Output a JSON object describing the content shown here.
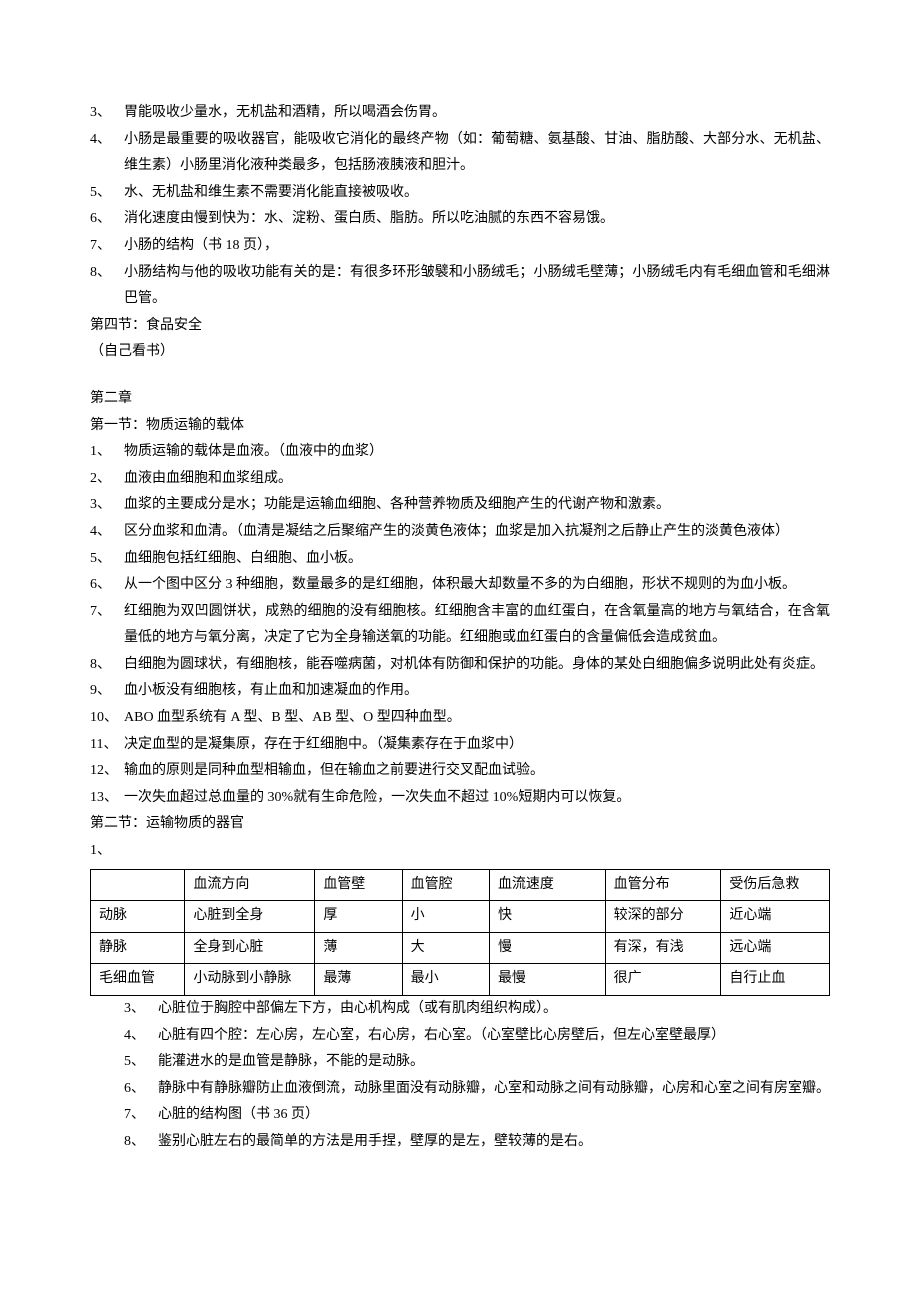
{
  "top_items": [
    {
      "num": "3、",
      "text": "胃能吸收少量水，无机盐和酒精，所以喝酒会伤胃。"
    },
    {
      "num": "4、",
      "text": "小肠是最重要的吸收器官，能吸收它消化的最终产物（如：葡萄糖、氨基酸、甘油、脂肪酸、大部分水、无机盐、维生素）小肠里消化液种类最多，包括肠液胰液和胆汁。"
    },
    {
      "num": "5、",
      "text": "水、无机盐和维生素不需要消化能直接被吸收。"
    },
    {
      "num": "6、",
      "text": "消化速度由慢到快为：水、淀粉、蛋白质、脂肪。所以吃油腻的东西不容易饿。"
    },
    {
      "num": "7、",
      "text": "小肠的结构（书 18 页），"
    },
    {
      "num": "8、",
      "text": "小肠结构与他的吸收功能有关的是：有很多环形皱襞和小肠绒毛；小肠绒毛壁薄；小肠绒毛内有毛细血管和毛细淋巴管。"
    }
  ],
  "section4_title": "第四节：食品安全",
  "section4_note": "（自己看书）",
  "chapter2_title": "第二章",
  "chapter2_section1_title": "第一节：物质运输的载体",
  "ch2s1_items": [
    {
      "num": "1、",
      "text": "物质运输的载体是血液。（血液中的血浆）"
    },
    {
      "num": "2、",
      "text": "血液由血细胞和血浆组成。"
    },
    {
      "num": "3、",
      "text": "血浆的主要成分是水；功能是运输血细胞、各种营养物质及细胞产生的代谢产物和激素。"
    },
    {
      "num": "4、",
      "text": "区分血浆和血清。（血清是凝结之后聚缩产生的淡黄色液体；血浆是加入抗凝剂之后静止产生的淡黄色液体）"
    },
    {
      "num": "5、",
      "text": "血细胞包括红细胞、白细胞、血小板。"
    },
    {
      "num": "6、",
      "text": "从一个图中区分 3 种细胞，数量最多的是红细胞，体积最大却数量不多的为白细胞，形状不规则的为血小板。"
    },
    {
      "num": "7、",
      "text": "红细胞为双凹圆饼状，成熟的细胞的没有细胞核。红细胞含丰富的血红蛋白，在含氧量高的地方与氧结合，在含氧量低的地方与氧分离，决定了它为全身输送氧的功能。红细胞或血红蛋白的含量偏低会造成贫血。"
    },
    {
      "num": "8、",
      "text": "白细胞为圆球状，有细胞核，能吞噬病菌，对机体有防御和保护的功能。身体的某处白细胞偏多说明此处有炎症。"
    },
    {
      "num": "9、",
      "text": "血小板没有细胞核，有止血和加速凝血的作用。"
    },
    {
      "num": "10、",
      "text": "ABO 血型系统有 A 型、B 型、AB 型、O 型四种血型。"
    },
    {
      "num": "11、",
      "text": "决定血型的是凝集原，存在于红细胞中。（凝集素存在于血浆中）"
    },
    {
      "num": "12、",
      "text": "输血的原则是同种血型相输血，但在输血之前要进行交叉配血试验。"
    },
    {
      "num": "13、",
      "text": "一次失血超过总血量的 30%就有生命危险，一次失血不超过 10%短期内可以恢复。"
    }
  ],
  "chapter2_section2_title": "第二节：运输物质的器官",
  "table_lead": "1、",
  "table": {
    "rows": [
      [
        "",
        "血流方向",
        "血管壁",
        "血管腔",
        "血流速度",
        "血管分布",
        "受伤后急救"
      ],
      [
        "动脉",
        "心脏到全身",
        "厚",
        "小",
        "快",
        "较深的部分",
        "近心端"
      ],
      [
        "静脉",
        "全身到心脏",
        "薄",
        "大",
        "慢",
        "有深，有浅",
        "远心端"
      ],
      [
        "毛细血管",
        "小动脉到小静脉",
        "最薄",
        "最小",
        "最慢",
        "很广",
        "自行止血"
      ]
    ]
  },
  "ch2s2_items": [
    {
      "num": "3、",
      "text": "心脏位于胸腔中部偏左下方，由心机构成（或有肌肉组织构成）。"
    },
    {
      "num": "4、",
      "text": "心脏有四个腔：左心房，左心室，右心房，右心室。（心室壁比心房壁后，但左心室壁最厚）"
    },
    {
      "num": "5、",
      "text": "能灌进水的是血管是静脉，不能的是动脉。"
    },
    {
      "num": "6、",
      "text": "静脉中有静脉瓣防止血液倒流，动脉里面没有动脉瓣，心室和动脉之间有动脉瓣，心房和心室之间有房室瓣。"
    },
    {
      "num": "7、",
      "text": "心脏的结构图（书 36 页）"
    },
    {
      "num": "8、",
      "text": "鉴别心脏左右的最简单的方法是用手捏，壁厚的是左，壁较薄的是右。"
    }
  ]
}
